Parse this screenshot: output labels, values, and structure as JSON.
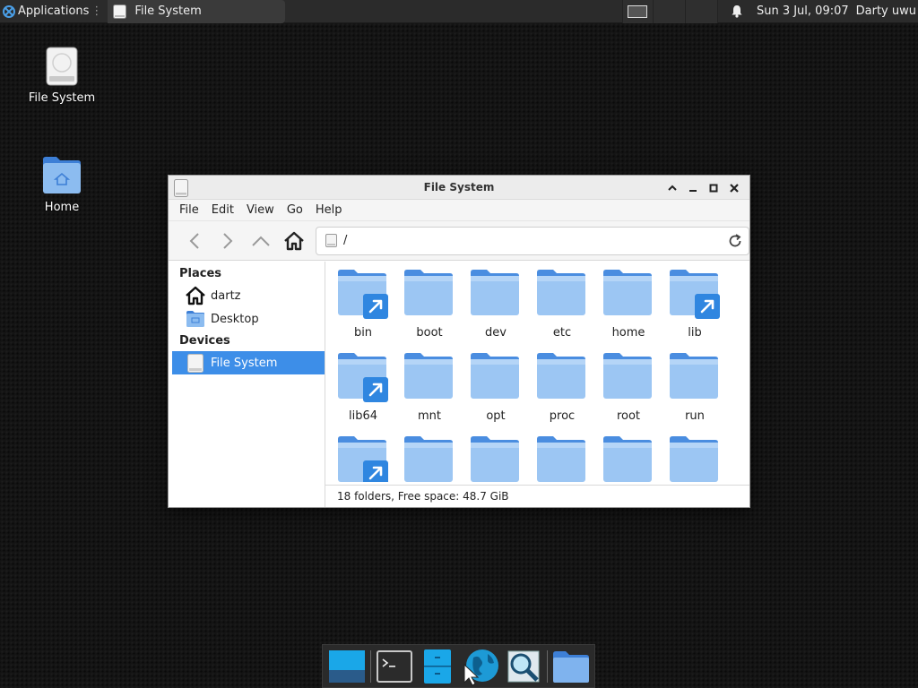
{
  "top_panel": {
    "applications_label": "Applications",
    "task_title": "File System",
    "clock": "Sun  3 Jul, 09:07",
    "user": "Darty uwu"
  },
  "desktop": {
    "icons": [
      {
        "label": "File System",
        "icon": "drive-icon"
      },
      {
        "label": "Home",
        "icon": "home-folder-icon"
      }
    ]
  },
  "window": {
    "title": "File System",
    "menu": [
      "File",
      "Edit",
      "View",
      "Go",
      "Help"
    ],
    "location": "/",
    "sidebar": {
      "places_heading": "Places",
      "places": [
        "dartz",
        "Desktop"
      ],
      "devices_heading": "Devices",
      "devices": [
        "File System"
      ]
    },
    "folders": [
      {
        "name": "bin",
        "link": true
      },
      {
        "name": "boot",
        "link": false
      },
      {
        "name": "dev",
        "link": false
      },
      {
        "name": "etc",
        "link": false
      },
      {
        "name": "home",
        "link": false
      },
      {
        "name": "lib",
        "link": true
      },
      {
        "name": "lib64",
        "link": true
      },
      {
        "name": "mnt",
        "link": false
      },
      {
        "name": "opt",
        "link": false
      },
      {
        "name": "proc",
        "link": false
      },
      {
        "name": "root",
        "link": false
      },
      {
        "name": "run",
        "link": false
      },
      {
        "name": "",
        "link": true
      },
      {
        "name": "",
        "link": false
      },
      {
        "name": "",
        "link": false
      },
      {
        "name": "",
        "link": false
      },
      {
        "name": "",
        "link": false
      },
      {
        "name": "",
        "link": false
      }
    ],
    "status": "18 folders, Free space: 48.7 GiB"
  },
  "dock": {
    "items": [
      "show-desktop-icon",
      "terminal-icon",
      "file-cabinet-icon",
      "web-browser-icon",
      "search-icon",
      "folder-icon"
    ]
  },
  "colors": {
    "accent": "#3d8ee8",
    "folder": "#6aa6e8",
    "panel": "#2b2b2b"
  }
}
